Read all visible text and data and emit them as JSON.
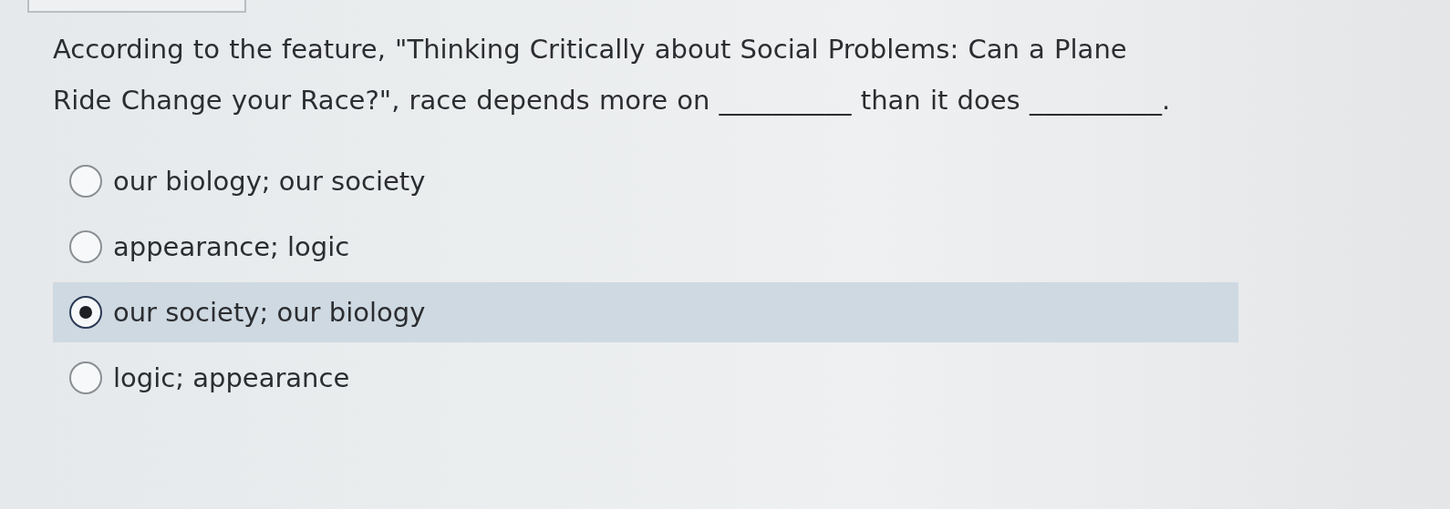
{
  "question": "According to the feature, \"Thinking Critically about Social Problems: Can a Plane Ride Change your Race?\", race depends more on __________ than it does __________.",
  "options": [
    {
      "label": "our biology; our society",
      "selected": false
    },
    {
      "label": "appearance; logic",
      "selected": false
    },
    {
      "label": "our society; our biology",
      "selected": true
    },
    {
      "label": "logic; appearance",
      "selected": false
    }
  ]
}
